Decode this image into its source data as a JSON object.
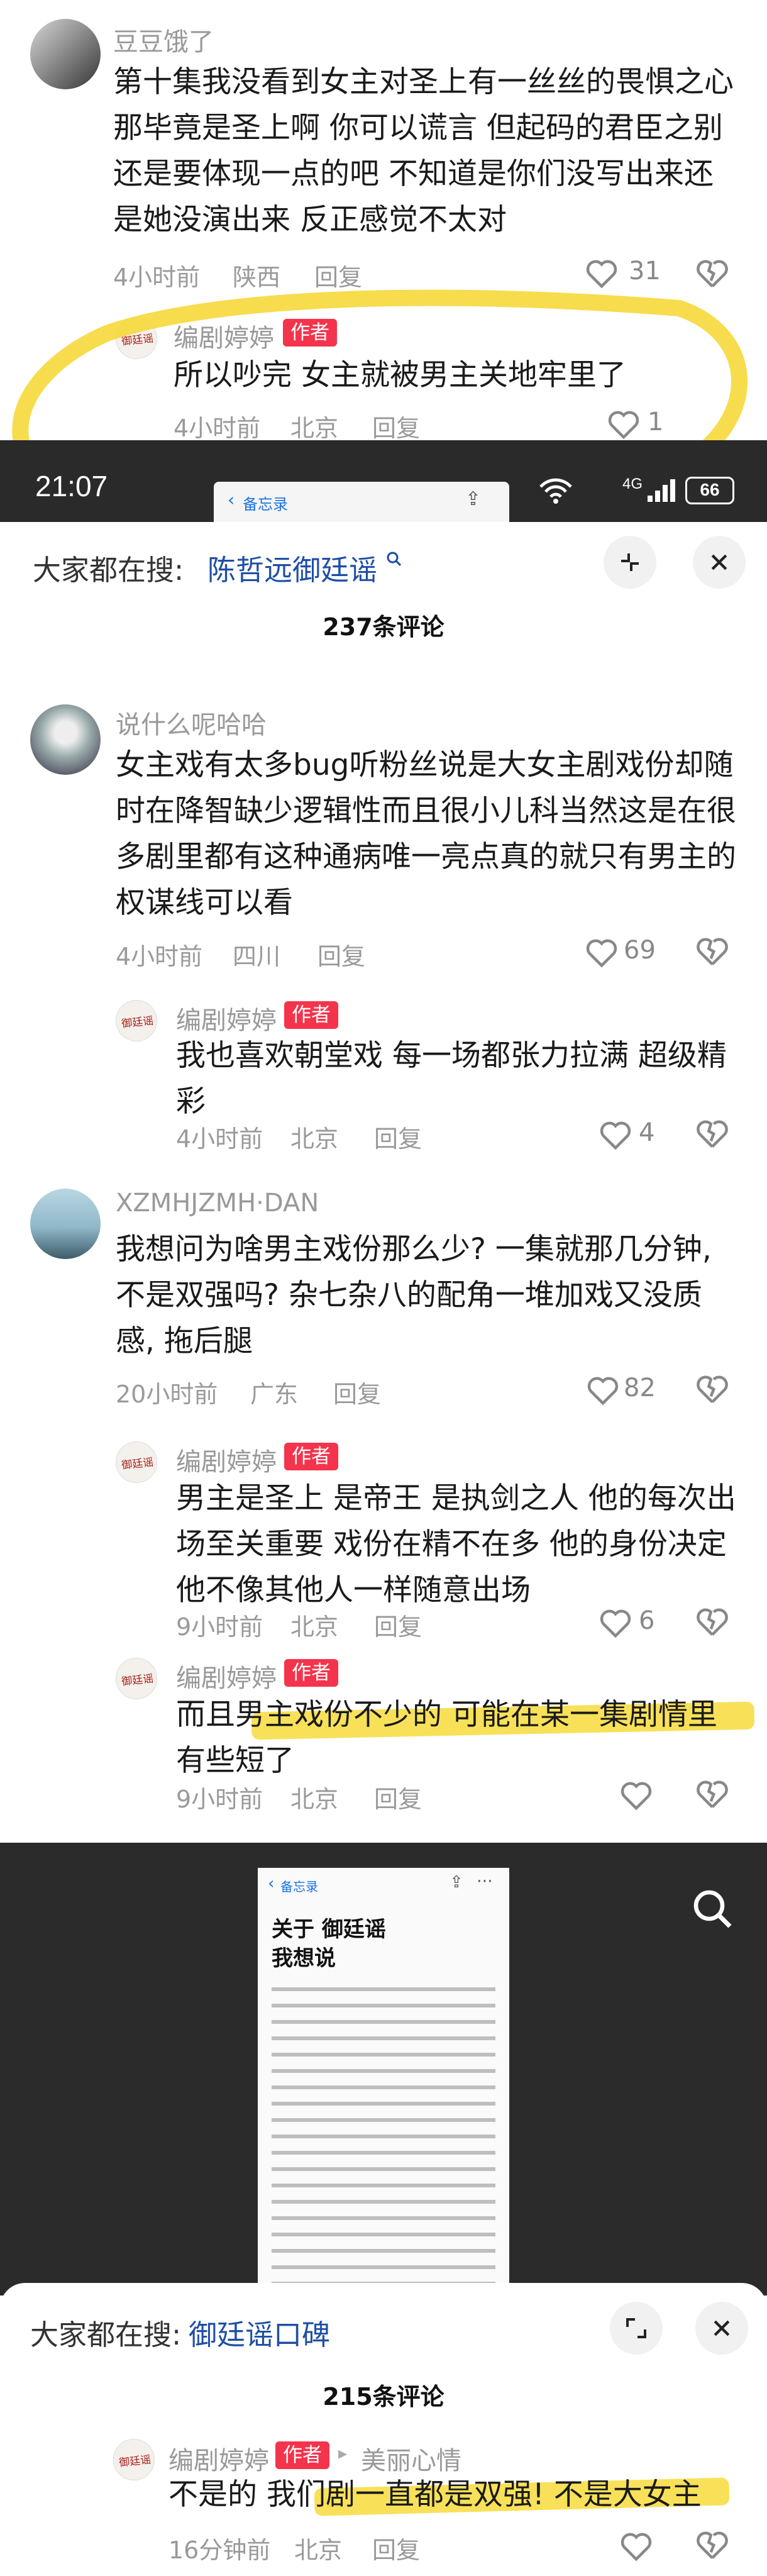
{
  "section1": {
    "comment": {
      "user": "豆豆饿了",
      "lines": [
        "第十集我没看到女主对圣上有一丝丝的畏惧之心",
        "那毕竟是圣上啊 你可以谎言 但起码的君臣之别",
        "还是要体现一点的吧 不知道是你们没写出来还",
        "是她没演出来 反正感觉不太对"
      ],
      "time": "4小时前",
      "location": "陕西",
      "reply": "回复",
      "likes": "31"
    },
    "reply": {
      "user": "编剧婷婷",
      "tag": "作者",
      "lines": [
        "所以吵完 女主就被男主关地牢里了"
      ],
      "time": "4小时前",
      "location": "北京",
      "reply": "回复",
      "likes": "1"
    }
  },
  "status_bar": {
    "time": "21:07",
    "memo_label": "备忘录",
    "network": "4G",
    "battery": "66"
  },
  "sheet1": {
    "search_label": "大家都在搜:",
    "search_term": "陈哲远御廷谣",
    "comment_count": "237条评论",
    "comments": [
      {
        "user": "说什么呢哈哈",
        "lines": [
          "女主戏有太多bug听粉丝说是大女主剧戏份却随",
          "时在降智缺少逻辑性而且很小儿科当然这是在很",
          "多剧里都有这种通病唯一亮点真的就只有男主的",
          "权谋线可以看"
        ],
        "time": "4小时前",
        "location": "四川",
        "reply": "回复",
        "likes": "69"
      },
      {
        "user": "编剧婷婷",
        "tag": "作者",
        "lines": [
          "我也喜欢朝堂戏 每一场都张力拉满 超级精",
          "彩"
        ],
        "time": "4小时前",
        "location": "北京",
        "reply": "回复",
        "likes": "4"
      },
      {
        "user": "XZMHJZMH·DAN",
        "lines": [
          "我想问为啥男主戏份那么少? 一集就那几分钟,",
          "不是双强吗? 杂七杂八的配角一堆加戏又没质",
          "感, 拖后腿"
        ],
        "time": "20小时前",
        "location": "广东",
        "reply": "回复",
        "likes": "82"
      },
      {
        "user": "编剧婷婷",
        "tag": "作者",
        "lines": [
          "男主是圣上 是帝王 是执剑之人 他的每次出",
          "场至关重要 戏份在精不在多 他的身份决定",
          "他不像其他人一样随意出场"
        ],
        "time": "9小时前",
        "location": "北京",
        "reply": "回复",
        "likes": "6"
      },
      {
        "user": "编剧婷婷",
        "tag": "作者",
        "lines": [
          "而且男主戏份不少的 可能在某一集剧情里",
          "有些短了"
        ],
        "time": "9小时前",
        "location": "北京",
        "reply": "回复",
        "likes": ""
      }
    ]
  },
  "memo": {
    "back_label": "备忘录",
    "title_line1": "关于 御廷谣",
    "title_line2": "我想说"
  },
  "sheet2": {
    "search_label": "大家都在搜:",
    "search_term": "御廷谣口碑",
    "comment_count": "215条评论",
    "comment": {
      "user": "编剧婷婷",
      "tag": "作者",
      "reply_to": "美丽心情",
      "lines": [
        "不是的 我们剧一直都是双强! 不是大女主"
      ],
      "time": "16分钟前",
      "location": "北京",
      "reply": "回复"
    }
  },
  "avatar_seal_text": "御廷谣",
  "colors": {
    "accent_tag": "#f4344c",
    "search_term": "#1f4fa6",
    "highlight": "#f7dc3c",
    "dark_band": "#2b2b2b"
  },
  "icons": [
    "heart-icon",
    "dislike-heart-icon",
    "search-icon",
    "close-icon",
    "collapse-icon",
    "expand-icon",
    "share-icon",
    "more-icon",
    "back-chevron-icon"
  ]
}
